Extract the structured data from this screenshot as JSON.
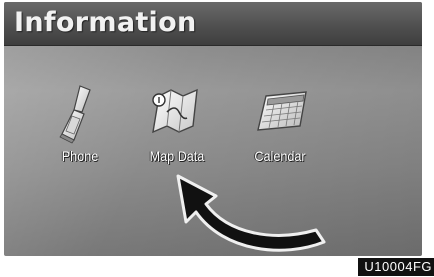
{
  "screen": {
    "title": "Information",
    "items": [
      {
        "label": "Phone",
        "icon": "phone-icon"
      },
      {
        "label": "Map Data",
        "icon": "map-data-icon"
      },
      {
        "label": "Calendar",
        "icon": "calendar-icon"
      }
    ]
  },
  "figure": {
    "code": "U10004FG"
  },
  "colors": {
    "title_text": "#f2f2f2",
    "background": "#8c8c8c",
    "arrow": "#111111"
  }
}
